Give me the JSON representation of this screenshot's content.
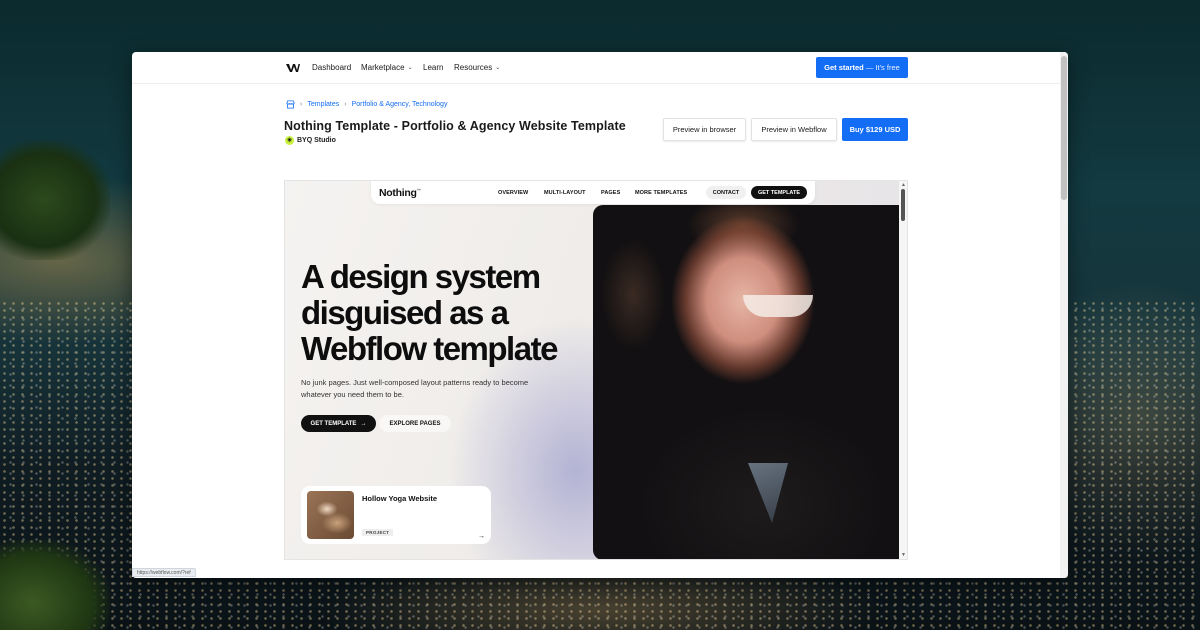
{
  "nav": {
    "items": [
      {
        "label": "Dashboard",
        "has_chevron": false
      },
      {
        "label": "Marketplace",
        "has_chevron": true
      },
      {
        "label": "Learn",
        "has_chevron": false
      },
      {
        "label": "Resources",
        "has_chevron": true
      }
    ],
    "cta_label": "Get started",
    "cta_suffix": "— It's free"
  },
  "breadcrumb": {
    "items": [
      "Templates",
      "Portfolio & Agency, Technology"
    ]
  },
  "template": {
    "title": "Nothing Template - Portfolio & Agency Website Template",
    "author": "BYQ Studio"
  },
  "actions": {
    "preview_browser": "Preview in browser",
    "preview_webflow": "Preview in Webflow",
    "buy": "Buy  $129 USD"
  },
  "preview": {
    "logo": "Nothing",
    "logo_mark": "™",
    "links": [
      "OVERVIEW",
      "MULTI-LAYOUT",
      "PAGES",
      "MORE TEMPLATES"
    ],
    "contact": "CONTACT",
    "get_template": "GET TEMPLATE",
    "headline": "A design system disguised as a Webflow template",
    "subtext": "No junk pages. Just well-composed layout patterns ready to become whatever you need them to be.",
    "btn_primary": "GET TEMPLATE",
    "btn_secondary": "EXPLORE PAGES",
    "card": {
      "title": "Hollow Yoga Website",
      "tag": "PROJECT"
    }
  },
  "status_bar": {
    "url": "https://webflow.com/?ref"
  },
  "colors": {
    "accent": "#146ef5",
    "author_badge": "#c8f13b"
  }
}
